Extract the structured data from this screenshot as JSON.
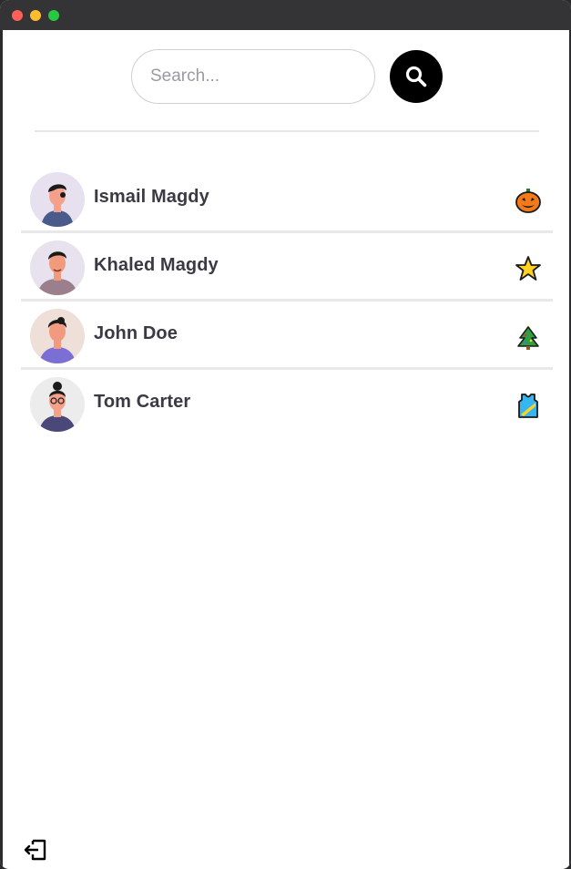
{
  "search": {
    "placeholder": "Search...",
    "value": ""
  },
  "contacts": [
    {
      "name": "Ismail Magdy",
      "status_icon": "pumpkin-icon",
      "avatar_bg": "#e6e0ef",
      "shirt": "#4a5a8a"
    },
    {
      "name": "Khaled Magdy",
      "status_icon": "star-icon",
      "avatar_bg": "#e8e2ee",
      "shirt": "#9c7f8d"
    },
    {
      "name": "John Doe",
      "status_icon": "christmas-tree-icon",
      "avatar_bg": "#eedfd8",
      "shirt": "#7b6fd6"
    },
    {
      "name": "Tom Carter",
      "status_icon": "jersey-icon",
      "avatar_bg": "#ececec",
      "shirt": "#4a4878"
    }
  ],
  "icons": {
    "search_button": "search-icon",
    "logout": "logout-icon"
  },
  "colors": {
    "accent": "#000000",
    "text": "#3a3a44",
    "divider": "#e8e8e8"
  }
}
